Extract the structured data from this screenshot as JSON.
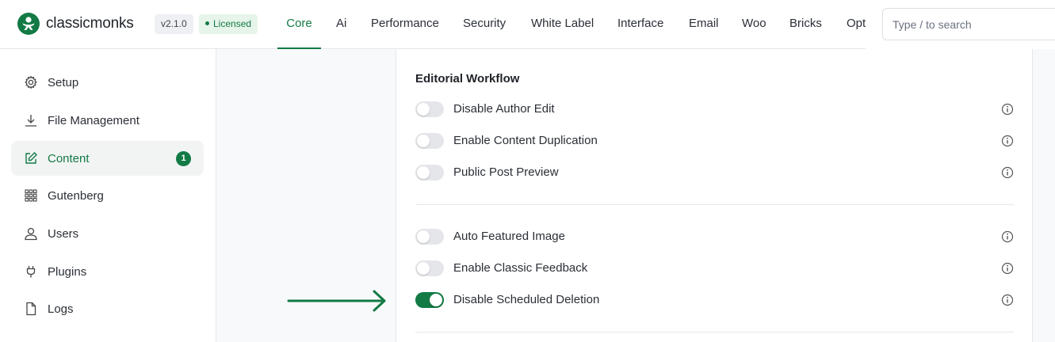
{
  "header": {
    "brand": "classicmonks",
    "version": "v2.1.0",
    "license": "Licensed",
    "tabs": [
      {
        "label": "Core",
        "active": true
      },
      {
        "label": "Ai"
      },
      {
        "label": "Performance"
      },
      {
        "label": "Security"
      },
      {
        "label": "White Label"
      },
      {
        "label": "Interface"
      },
      {
        "label": "Email"
      },
      {
        "label": "Woo"
      },
      {
        "label": "Bricks"
      },
      {
        "label": "Opt"
      }
    ],
    "search": {
      "placeholder": "Type / to search",
      "value": ""
    }
  },
  "sidebar": {
    "items": [
      {
        "label": "Setup",
        "icon": "gear-icon"
      },
      {
        "label": "File Management",
        "icon": "download-icon"
      },
      {
        "label": "Content",
        "icon": "edit-icon",
        "active": true,
        "badge": "1"
      },
      {
        "label": "Gutenberg",
        "icon": "grid-icon"
      },
      {
        "label": "Users",
        "icon": "user-icon"
      },
      {
        "label": "Plugins",
        "icon": "plug-icon"
      },
      {
        "label": "Logs",
        "icon": "file-icon"
      }
    ]
  },
  "main": {
    "section_title": "Editorial Workflow",
    "settings": [
      {
        "label": "Disable Author Edit",
        "enabled": false
      },
      {
        "label": "Enable Content Duplication",
        "enabled": false
      },
      {
        "label": "Public Post Preview",
        "enabled": false
      },
      {
        "label": "Auto Featured Image",
        "enabled": false
      },
      {
        "label": "Enable Classic Feedback",
        "enabled": false
      },
      {
        "label": "Disable Scheduled Deletion",
        "enabled": true
      }
    ]
  },
  "colors": {
    "accent": "#137a45",
    "toggle_off": "#e4e6ea",
    "arrow": "#137a45"
  }
}
